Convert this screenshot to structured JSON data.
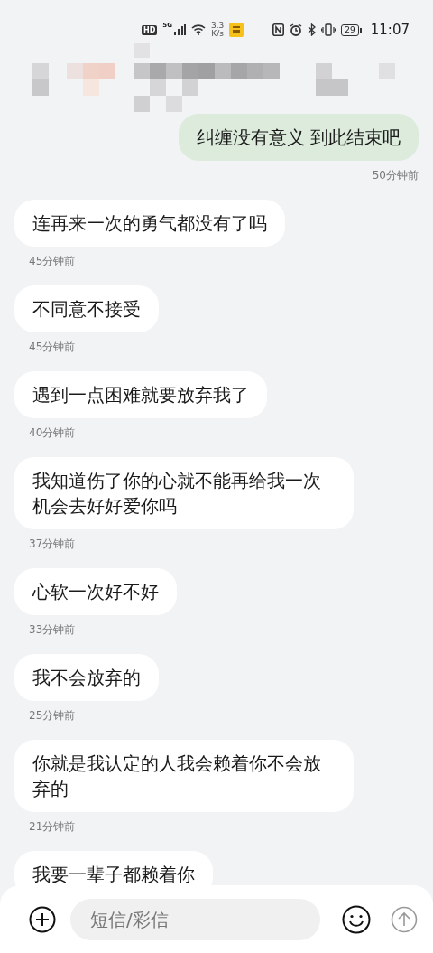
{
  "status_bar": {
    "hd": "HD",
    "network": "5G",
    "speed_value": "3.3",
    "speed_unit": "K/s",
    "battery": "29",
    "time": "11:07"
  },
  "messages": [
    {
      "kind": "sent",
      "text": "纠缠没有意义 到此结束吧",
      "time": "50分钟前"
    },
    {
      "kind": "received",
      "text": "连再来一次的勇气都没有了吗",
      "time": "45分钟前"
    },
    {
      "kind": "received",
      "text": "不同意不接受",
      "time": "45分钟前"
    },
    {
      "kind": "received",
      "text": "遇到一点困难就要放弃我了",
      "time": "40分钟前"
    },
    {
      "kind": "received",
      "text": "我知道伤了你的心就不能再给我一次机会去好好爱你吗",
      "time": "37分钟前"
    },
    {
      "kind": "received",
      "text": "心软一次好不好",
      "time": "33分钟前"
    },
    {
      "kind": "received",
      "text": "我不会放弃的",
      "time": "25分钟前"
    },
    {
      "kind": "received",
      "text": "你就是我认定的人我会赖着你不会放弃的",
      "time": "21分钟前"
    },
    {
      "kind": "received",
      "text": "我要一辈子都赖着你"
    }
  ],
  "composer": {
    "placeholder": "短信/彩信"
  }
}
